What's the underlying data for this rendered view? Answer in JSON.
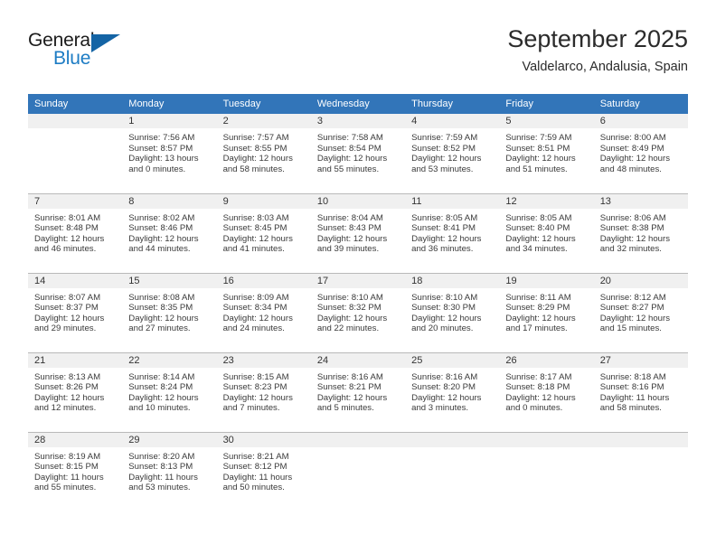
{
  "brand": {
    "name_part1": "General",
    "name_part2": "Blue",
    "triangle_color": "#1464a5",
    "blue_color": "#1d7cc4"
  },
  "header": {
    "title": "September 2025",
    "location": "Valdelarco, Andalusia, Spain"
  },
  "theme": {
    "header_bg": "#3275b9",
    "daynum_bg": "#f0f0f0",
    "grid_line": "#b9b9b9",
    "accent_line": "#2f6fad"
  },
  "weekdays": [
    "Sunday",
    "Monday",
    "Tuesday",
    "Wednesday",
    "Thursday",
    "Friday",
    "Saturday"
  ],
  "labels": {
    "sunrise_prefix": "Sunrise:",
    "sunset_prefix": "Sunset:",
    "daylight_prefix": "Daylight:"
  },
  "weeks": [
    [
      {
        "day": "",
        "sunrise": "",
        "sunset": "",
        "daylight": ""
      },
      {
        "day": "1",
        "sunrise": "Sunrise: 7:56 AM",
        "sunset": "Sunset: 8:57 PM",
        "daylight": "Daylight: 13 hours and 0 minutes."
      },
      {
        "day": "2",
        "sunrise": "Sunrise: 7:57 AM",
        "sunset": "Sunset: 8:55 PM",
        "daylight": "Daylight: 12 hours and 58 minutes."
      },
      {
        "day": "3",
        "sunrise": "Sunrise: 7:58 AM",
        "sunset": "Sunset: 8:54 PM",
        "daylight": "Daylight: 12 hours and 55 minutes."
      },
      {
        "day": "4",
        "sunrise": "Sunrise: 7:59 AM",
        "sunset": "Sunset: 8:52 PM",
        "daylight": "Daylight: 12 hours and 53 minutes."
      },
      {
        "day": "5",
        "sunrise": "Sunrise: 7:59 AM",
        "sunset": "Sunset: 8:51 PM",
        "daylight": "Daylight: 12 hours and 51 minutes."
      },
      {
        "day": "6",
        "sunrise": "Sunrise: 8:00 AM",
        "sunset": "Sunset: 8:49 PM",
        "daylight": "Daylight: 12 hours and 48 minutes."
      }
    ],
    [
      {
        "day": "7",
        "sunrise": "Sunrise: 8:01 AM",
        "sunset": "Sunset: 8:48 PM",
        "daylight": "Daylight: 12 hours and 46 minutes."
      },
      {
        "day": "8",
        "sunrise": "Sunrise: 8:02 AM",
        "sunset": "Sunset: 8:46 PM",
        "daylight": "Daylight: 12 hours and 44 minutes."
      },
      {
        "day": "9",
        "sunrise": "Sunrise: 8:03 AM",
        "sunset": "Sunset: 8:45 PM",
        "daylight": "Daylight: 12 hours and 41 minutes."
      },
      {
        "day": "10",
        "sunrise": "Sunrise: 8:04 AM",
        "sunset": "Sunset: 8:43 PM",
        "daylight": "Daylight: 12 hours and 39 minutes."
      },
      {
        "day": "11",
        "sunrise": "Sunrise: 8:05 AM",
        "sunset": "Sunset: 8:41 PM",
        "daylight": "Daylight: 12 hours and 36 minutes."
      },
      {
        "day": "12",
        "sunrise": "Sunrise: 8:05 AM",
        "sunset": "Sunset: 8:40 PM",
        "daylight": "Daylight: 12 hours and 34 minutes."
      },
      {
        "day": "13",
        "sunrise": "Sunrise: 8:06 AM",
        "sunset": "Sunset: 8:38 PM",
        "daylight": "Daylight: 12 hours and 32 minutes."
      }
    ],
    [
      {
        "day": "14",
        "sunrise": "Sunrise: 8:07 AM",
        "sunset": "Sunset: 8:37 PM",
        "daylight": "Daylight: 12 hours and 29 minutes."
      },
      {
        "day": "15",
        "sunrise": "Sunrise: 8:08 AM",
        "sunset": "Sunset: 8:35 PM",
        "daylight": "Daylight: 12 hours and 27 minutes."
      },
      {
        "day": "16",
        "sunrise": "Sunrise: 8:09 AM",
        "sunset": "Sunset: 8:34 PM",
        "daylight": "Daylight: 12 hours and 24 minutes."
      },
      {
        "day": "17",
        "sunrise": "Sunrise: 8:10 AM",
        "sunset": "Sunset: 8:32 PM",
        "daylight": "Daylight: 12 hours and 22 minutes."
      },
      {
        "day": "18",
        "sunrise": "Sunrise: 8:10 AM",
        "sunset": "Sunset: 8:30 PM",
        "daylight": "Daylight: 12 hours and 20 minutes."
      },
      {
        "day": "19",
        "sunrise": "Sunrise: 8:11 AM",
        "sunset": "Sunset: 8:29 PM",
        "daylight": "Daylight: 12 hours and 17 minutes."
      },
      {
        "day": "20",
        "sunrise": "Sunrise: 8:12 AM",
        "sunset": "Sunset: 8:27 PM",
        "daylight": "Daylight: 12 hours and 15 minutes."
      }
    ],
    [
      {
        "day": "21",
        "sunrise": "Sunrise: 8:13 AM",
        "sunset": "Sunset: 8:26 PM",
        "daylight": "Daylight: 12 hours and 12 minutes."
      },
      {
        "day": "22",
        "sunrise": "Sunrise: 8:14 AM",
        "sunset": "Sunset: 8:24 PM",
        "daylight": "Daylight: 12 hours and 10 minutes."
      },
      {
        "day": "23",
        "sunrise": "Sunrise: 8:15 AM",
        "sunset": "Sunset: 8:23 PM",
        "daylight": "Daylight: 12 hours and 7 minutes."
      },
      {
        "day": "24",
        "sunrise": "Sunrise: 8:16 AM",
        "sunset": "Sunset: 8:21 PM",
        "daylight": "Daylight: 12 hours and 5 minutes."
      },
      {
        "day": "25",
        "sunrise": "Sunrise: 8:16 AM",
        "sunset": "Sunset: 8:20 PM",
        "daylight": "Daylight: 12 hours and 3 minutes."
      },
      {
        "day": "26",
        "sunrise": "Sunrise: 8:17 AM",
        "sunset": "Sunset: 8:18 PM",
        "daylight": "Daylight: 12 hours and 0 minutes."
      },
      {
        "day": "27",
        "sunrise": "Sunrise: 8:18 AM",
        "sunset": "Sunset: 8:16 PM",
        "daylight": "Daylight: 11 hours and 58 minutes."
      }
    ],
    [
      {
        "day": "28",
        "sunrise": "Sunrise: 8:19 AM",
        "sunset": "Sunset: 8:15 PM",
        "daylight": "Daylight: 11 hours and 55 minutes."
      },
      {
        "day": "29",
        "sunrise": "Sunrise: 8:20 AM",
        "sunset": "Sunset: 8:13 PM",
        "daylight": "Daylight: 11 hours and 53 minutes."
      },
      {
        "day": "30",
        "sunrise": "Sunrise: 8:21 AM",
        "sunset": "Sunset: 8:12 PM",
        "daylight": "Daylight: 11 hours and 50 minutes."
      },
      {
        "day": "",
        "sunrise": "",
        "sunset": "",
        "daylight": ""
      },
      {
        "day": "",
        "sunrise": "",
        "sunset": "",
        "daylight": ""
      },
      {
        "day": "",
        "sunrise": "",
        "sunset": "",
        "daylight": ""
      },
      {
        "day": "",
        "sunrise": "",
        "sunset": "",
        "daylight": ""
      }
    ]
  ]
}
